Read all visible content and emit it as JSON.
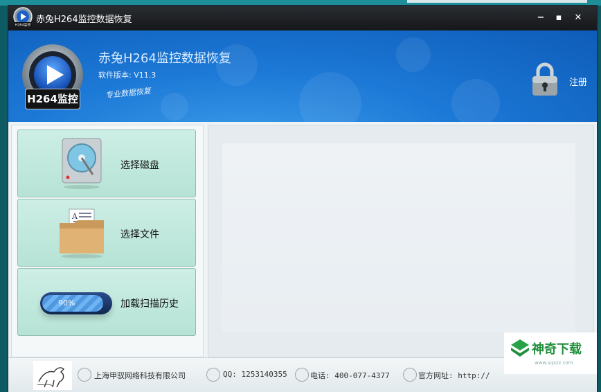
{
  "window": {
    "title": "赤兔H264监控数据恢复",
    "logo_label_small": "H264监控",
    "controls": {
      "minimize": "−",
      "maximize": "▪",
      "close": "✕"
    }
  },
  "header": {
    "app_name": "赤兔H264监控数据恢复",
    "version": "软件版本: V11.3",
    "logo_label": "H264监控",
    "slogan": "专业数据恢复",
    "register_label": "注册",
    "accent_color": "#1c78d6"
  },
  "nav": {
    "items": [
      {
        "label": "选择磁盘",
        "icon": "hard-disk-icon"
      },
      {
        "label": "选择文件",
        "icon": "folder-document-icon"
      },
      {
        "label": "加载扫描历史",
        "icon": "progress-icon",
        "progress_text": "90%",
        "progress_value": 0.9
      }
    ]
  },
  "status": {
    "company": "上海甲驭网络科技有限公司",
    "qq": "QQ: 1253140355",
    "phone": "电话: 400-077-4377",
    "website": "官方网址: http://"
  },
  "watermark": {
    "text": "神奇下载",
    "url": "www.sqxzz.com"
  }
}
